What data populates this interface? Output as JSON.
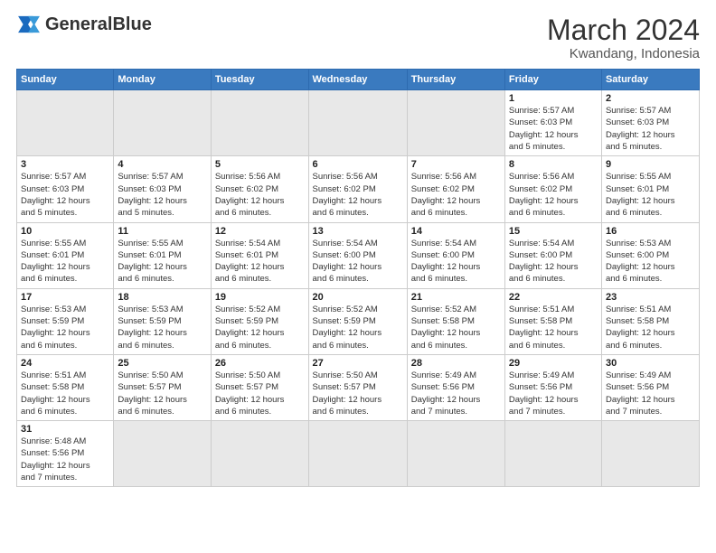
{
  "header": {
    "logo_text_normal": "General",
    "logo_text_bold": "Blue",
    "month_title": "March 2024",
    "location": "Kwandang, Indonesia"
  },
  "weekdays": [
    "Sunday",
    "Monday",
    "Tuesday",
    "Wednesday",
    "Thursday",
    "Friday",
    "Saturday"
  ],
  "weeks": [
    [
      {
        "day": "",
        "info": "",
        "empty": true
      },
      {
        "day": "",
        "info": "",
        "empty": true
      },
      {
        "day": "",
        "info": "",
        "empty": true
      },
      {
        "day": "",
        "info": "",
        "empty": true
      },
      {
        "day": "",
        "info": "",
        "empty": true
      },
      {
        "day": "1",
        "info": "Sunrise: 5:57 AM\nSunset: 6:03 PM\nDaylight: 12 hours\nand 5 minutes."
      },
      {
        "day": "2",
        "info": "Sunrise: 5:57 AM\nSunset: 6:03 PM\nDaylight: 12 hours\nand 5 minutes."
      }
    ],
    [
      {
        "day": "3",
        "info": "Sunrise: 5:57 AM\nSunset: 6:03 PM\nDaylight: 12 hours\nand 5 minutes."
      },
      {
        "day": "4",
        "info": "Sunrise: 5:57 AM\nSunset: 6:03 PM\nDaylight: 12 hours\nand 5 minutes."
      },
      {
        "day": "5",
        "info": "Sunrise: 5:56 AM\nSunset: 6:02 PM\nDaylight: 12 hours\nand 6 minutes."
      },
      {
        "day": "6",
        "info": "Sunrise: 5:56 AM\nSunset: 6:02 PM\nDaylight: 12 hours\nand 6 minutes."
      },
      {
        "day": "7",
        "info": "Sunrise: 5:56 AM\nSunset: 6:02 PM\nDaylight: 12 hours\nand 6 minutes."
      },
      {
        "day": "8",
        "info": "Sunrise: 5:56 AM\nSunset: 6:02 PM\nDaylight: 12 hours\nand 6 minutes."
      },
      {
        "day": "9",
        "info": "Sunrise: 5:55 AM\nSunset: 6:01 PM\nDaylight: 12 hours\nand 6 minutes."
      }
    ],
    [
      {
        "day": "10",
        "info": "Sunrise: 5:55 AM\nSunset: 6:01 PM\nDaylight: 12 hours\nand 6 minutes."
      },
      {
        "day": "11",
        "info": "Sunrise: 5:55 AM\nSunset: 6:01 PM\nDaylight: 12 hours\nand 6 minutes."
      },
      {
        "day": "12",
        "info": "Sunrise: 5:54 AM\nSunset: 6:01 PM\nDaylight: 12 hours\nand 6 minutes."
      },
      {
        "day": "13",
        "info": "Sunrise: 5:54 AM\nSunset: 6:00 PM\nDaylight: 12 hours\nand 6 minutes."
      },
      {
        "day": "14",
        "info": "Sunrise: 5:54 AM\nSunset: 6:00 PM\nDaylight: 12 hours\nand 6 minutes."
      },
      {
        "day": "15",
        "info": "Sunrise: 5:54 AM\nSunset: 6:00 PM\nDaylight: 12 hours\nand 6 minutes."
      },
      {
        "day": "16",
        "info": "Sunrise: 5:53 AM\nSunset: 6:00 PM\nDaylight: 12 hours\nand 6 minutes."
      }
    ],
    [
      {
        "day": "17",
        "info": "Sunrise: 5:53 AM\nSunset: 5:59 PM\nDaylight: 12 hours\nand 6 minutes."
      },
      {
        "day": "18",
        "info": "Sunrise: 5:53 AM\nSunset: 5:59 PM\nDaylight: 12 hours\nand 6 minutes."
      },
      {
        "day": "19",
        "info": "Sunrise: 5:52 AM\nSunset: 5:59 PM\nDaylight: 12 hours\nand 6 minutes."
      },
      {
        "day": "20",
        "info": "Sunrise: 5:52 AM\nSunset: 5:59 PM\nDaylight: 12 hours\nand 6 minutes."
      },
      {
        "day": "21",
        "info": "Sunrise: 5:52 AM\nSunset: 5:58 PM\nDaylight: 12 hours\nand 6 minutes."
      },
      {
        "day": "22",
        "info": "Sunrise: 5:51 AM\nSunset: 5:58 PM\nDaylight: 12 hours\nand 6 minutes."
      },
      {
        "day": "23",
        "info": "Sunrise: 5:51 AM\nSunset: 5:58 PM\nDaylight: 12 hours\nand 6 minutes."
      }
    ],
    [
      {
        "day": "24",
        "info": "Sunrise: 5:51 AM\nSunset: 5:58 PM\nDaylight: 12 hours\nand 6 minutes."
      },
      {
        "day": "25",
        "info": "Sunrise: 5:50 AM\nSunset: 5:57 PM\nDaylight: 12 hours\nand 6 minutes."
      },
      {
        "day": "26",
        "info": "Sunrise: 5:50 AM\nSunset: 5:57 PM\nDaylight: 12 hours\nand 6 minutes."
      },
      {
        "day": "27",
        "info": "Sunrise: 5:50 AM\nSunset: 5:57 PM\nDaylight: 12 hours\nand 6 minutes."
      },
      {
        "day": "28",
        "info": "Sunrise: 5:49 AM\nSunset: 5:56 PM\nDaylight: 12 hours\nand 7 minutes."
      },
      {
        "day": "29",
        "info": "Sunrise: 5:49 AM\nSunset: 5:56 PM\nDaylight: 12 hours\nand 7 minutes."
      },
      {
        "day": "30",
        "info": "Sunrise: 5:49 AM\nSunset: 5:56 PM\nDaylight: 12 hours\nand 7 minutes."
      }
    ],
    [
      {
        "day": "31",
        "info": "Sunrise: 5:48 AM\nSunset: 5:56 PM\nDaylight: 12 hours\nand 7 minutes.",
        "active": true
      },
      {
        "day": "",
        "info": "",
        "empty": true
      },
      {
        "day": "",
        "info": "",
        "empty": true
      },
      {
        "day": "",
        "info": "",
        "empty": true
      },
      {
        "day": "",
        "info": "",
        "empty": true
      },
      {
        "day": "",
        "info": "",
        "empty": true
      },
      {
        "day": "",
        "info": "",
        "empty": true
      }
    ]
  ]
}
